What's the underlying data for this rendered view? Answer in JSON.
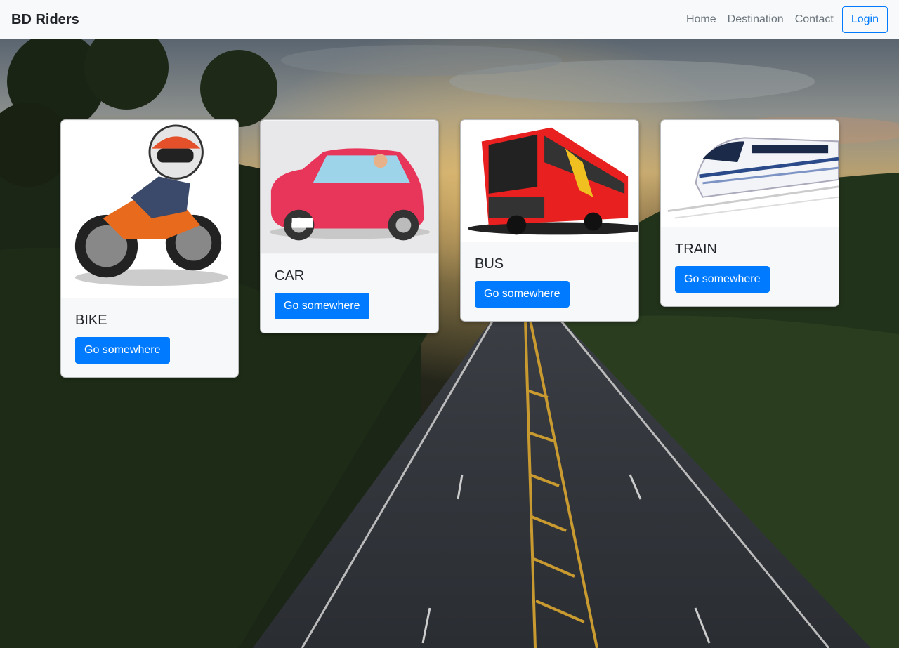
{
  "navbar": {
    "brand": "BD Riders",
    "links": [
      "Home",
      "Destination",
      "Contact"
    ],
    "login": "Login"
  },
  "cards": [
    {
      "title": "BIKE",
      "button": "Go somewhere",
      "icon": "motorbike-rider-image"
    },
    {
      "title": "CAR",
      "button": "Go somewhere",
      "icon": "car-image"
    },
    {
      "title": "BUS",
      "button": "Go somewhere",
      "icon": "bus-image"
    },
    {
      "title": "TRAIN",
      "button": "Go somewhere",
      "icon": "train-image"
    }
  ],
  "colors": {
    "primary": "#007bff",
    "navbar_bg": "#f8f9fa",
    "card_bg": "#f7f8fa"
  }
}
